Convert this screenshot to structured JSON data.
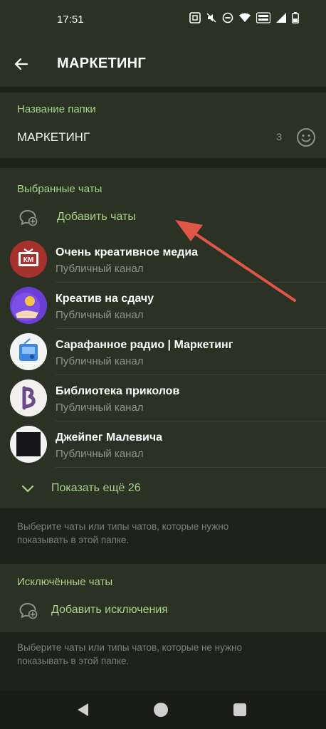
{
  "status_bar": {
    "time": "17:51"
  },
  "app_bar": {
    "title": "МАРКЕТИНГ"
  },
  "folder_section": {
    "label": "Название папки",
    "name_value": "МАРКЕТИНГ",
    "char_count": "3"
  },
  "included_section": {
    "label": "Выбранные чаты",
    "add_label": "Добавить чаты",
    "chats": [
      {
        "title": "Очень креативное медиа",
        "subtitle": "Публичный канал",
        "avatar_text": "КМ"
      },
      {
        "title": "Креатив на сдачу",
        "subtitle": "Публичный канал"
      },
      {
        "title": "Сарафанное радио | Маркетинг",
        "subtitle": "Публичный канал"
      },
      {
        "title": "Библиотека приколов",
        "subtitle": "Публичный канал"
      },
      {
        "title": "Джейпег Малевича",
        "subtitle": "Публичный канал"
      }
    ],
    "show_more_label": "Показать ещё 26",
    "hint": "Выберите чаты или типы чатов, которые нужно показывать в этой папке."
  },
  "excluded_section": {
    "label": "Исключённые чаты",
    "add_label": "Добавить исключения",
    "hint": "Выберите чаты или типы чатов, которые не нужно показывать в этой папке."
  },
  "colors": {
    "accent": "#a6d48a",
    "background": "#1e2219",
    "surface": "#2b3224",
    "annotation_arrow": "#e0574a"
  }
}
